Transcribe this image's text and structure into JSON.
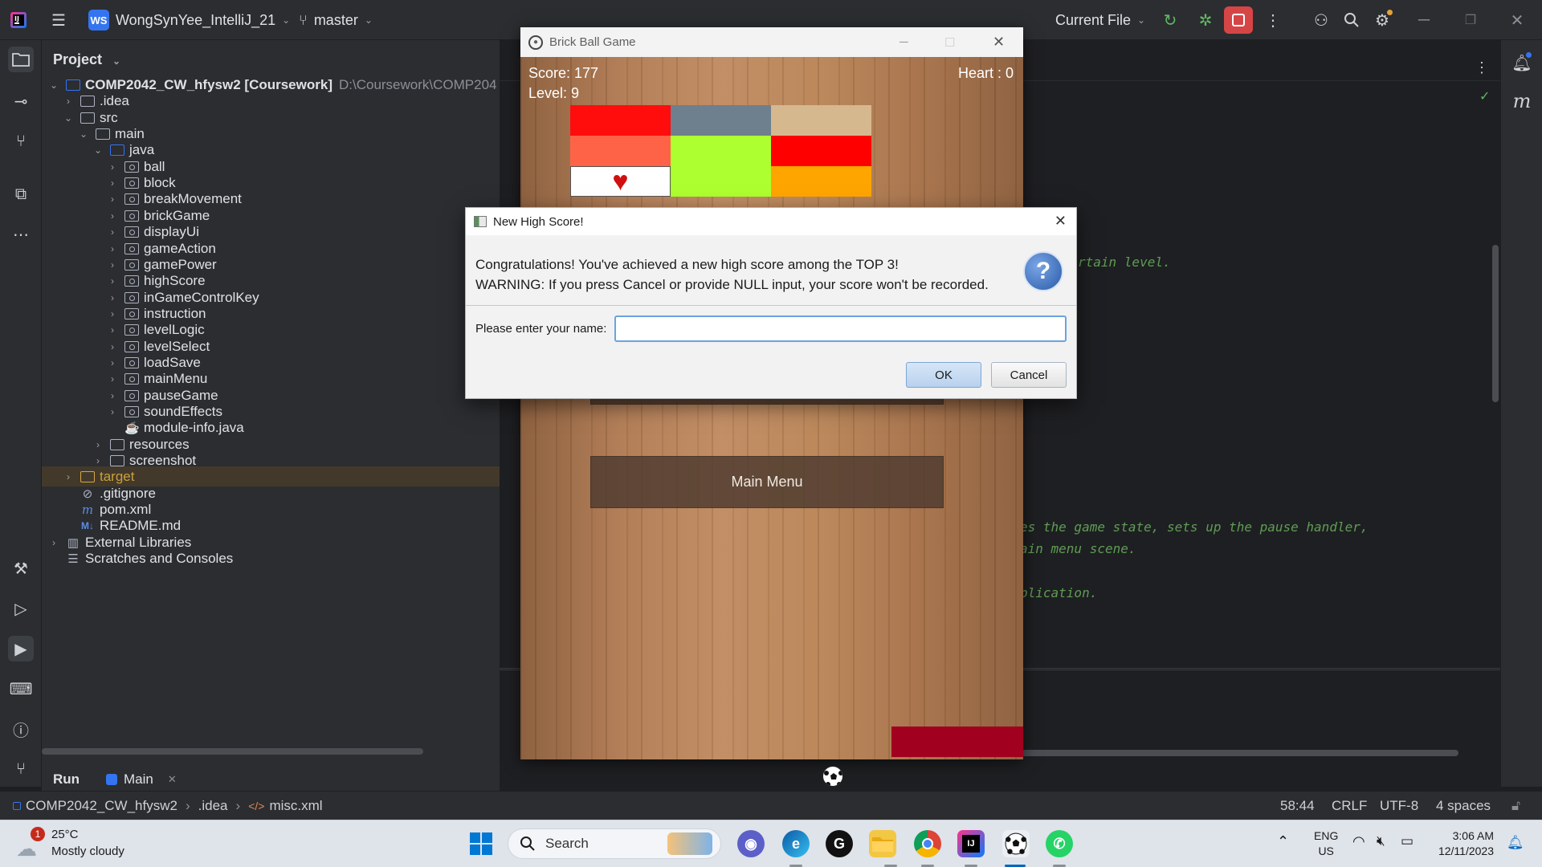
{
  "ide": {
    "project_badge": "WS",
    "project_name": "WongSynYee_IntelliJ_21",
    "branch": "master",
    "run_config": "Current File"
  },
  "project_panel": {
    "title": "Project",
    "tree": [
      {
        "label": "COMP2042_CW_hfysw2 [Coursework]",
        "extra": "D:\\Coursework\\COMP204",
        "indent": 0,
        "expanded": true,
        "icon": "module-folder"
      },
      {
        "label": ".idea",
        "indent": 1,
        "expanded": false,
        "icon": "folder"
      },
      {
        "label": "src",
        "indent": 1,
        "expanded": true,
        "icon": "folder"
      },
      {
        "label": "main",
        "indent": 2,
        "expanded": true,
        "icon": "folder"
      },
      {
        "label": "java",
        "indent": 3,
        "expanded": true,
        "icon": "source-folder"
      },
      {
        "label": "ball",
        "indent": 4,
        "expanded": false,
        "icon": "package"
      },
      {
        "label": "block",
        "indent": 4,
        "expanded": false,
        "icon": "package"
      },
      {
        "label": "breakMovement",
        "indent": 4,
        "expanded": false,
        "icon": "package"
      },
      {
        "label": "brickGame",
        "indent": 4,
        "expanded": false,
        "icon": "package"
      },
      {
        "label": "displayUi",
        "indent": 4,
        "expanded": false,
        "icon": "package"
      },
      {
        "label": "gameAction",
        "indent": 4,
        "expanded": false,
        "icon": "package"
      },
      {
        "label": "gamePower",
        "indent": 4,
        "expanded": false,
        "icon": "package"
      },
      {
        "label": "highScore",
        "indent": 4,
        "expanded": false,
        "icon": "package"
      },
      {
        "label": "inGameControlKey",
        "indent": 4,
        "expanded": false,
        "icon": "package"
      },
      {
        "label": "instruction",
        "indent": 4,
        "expanded": false,
        "icon": "package"
      },
      {
        "label": "levelLogic",
        "indent": 4,
        "expanded": false,
        "icon": "package"
      },
      {
        "label": "levelSelect",
        "indent": 4,
        "expanded": false,
        "icon": "package"
      },
      {
        "label": "loadSave",
        "indent": 4,
        "expanded": false,
        "icon": "package"
      },
      {
        "label": "mainMenu",
        "indent": 4,
        "expanded": false,
        "icon": "package"
      },
      {
        "label": "pauseGame",
        "indent": 4,
        "expanded": false,
        "icon": "package"
      },
      {
        "label": "soundEffects",
        "indent": 4,
        "expanded": false,
        "icon": "package"
      },
      {
        "label": "module-info.java",
        "indent": 4,
        "icon": "java-file"
      },
      {
        "label": "resources",
        "indent": 3,
        "expanded": false,
        "icon": "folder"
      },
      {
        "label": "screenshot",
        "indent": 3,
        "expanded": false,
        "icon": "folder"
      },
      {
        "label": "target",
        "indent": 1,
        "expanded": false,
        "icon": "excluded-folder",
        "selected": true
      },
      {
        "label": ".gitignore",
        "indent": 1,
        "icon": "ignore-file"
      },
      {
        "label": "pom.xml",
        "indent": 1,
        "icon": "maven-file"
      },
      {
        "label": "README.md",
        "indent": 1,
        "icon": "markdown-file"
      },
      {
        "label": "External Libraries",
        "indent": 0,
        "expanded": false,
        "icon": "library"
      },
      {
        "label": "Scratches and Consoles",
        "indent": 0,
        "icon": "scratches"
      }
    ]
  },
  "editor": {
    "comment_lines": [
      "rtain level.",
      "es the game state, sets up the pause handler,",
      "ain menu scene.",
      "plication."
    ]
  },
  "run_bar": {
    "label": "Run",
    "tab": "Main"
  },
  "status_bar": {
    "breadcrumb": [
      "COMP2042_CW_hfysw2",
      ".idea",
      "misc.xml"
    ],
    "position": "58:44",
    "line_sep": "CRLF",
    "encoding": "UTF-8",
    "indent": "4 spaces"
  },
  "game_window": {
    "title": "Brick Ball Game",
    "score_text": "Score: 177",
    "level_text": "Level: 9",
    "heart_text": "Heart : 0",
    "main_menu_button": "Main Menu",
    "brick_colors": [
      [
        "#ff0d0d",
        "#6e7f8e",
        "#d6b88f"
      ],
      [
        "#ff6347",
        "#adff2f",
        "#ff0000"
      ],
      [
        "#ffffff",
        "#adff2f",
        "#ffa500"
      ]
    ],
    "paddle_color": "#a1001e"
  },
  "dialog": {
    "title": "New High Score!",
    "message_line1": "Congratulations! You've achieved a new high score among the TOP 3!",
    "message_line2": "WARNING: If you press Cancel or provide NULL input, your score won't be recorded.",
    "prompt_label": "Please enter your name:",
    "input_value": "",
    "ok_label": "OK",
    "cancel_label": "Cancel"
  },
  "taskbar": {
    "weather_temp": "25°C",
    "weather_desc": "Mostly cloudy",
    "weather_badge": "1",
    "search_label": "Search",
    "lang_top": "ENG",
    "lang_bottom": "US",
    "time": "3:06 AM",
    "date": "12/11/2023"
  }
}
